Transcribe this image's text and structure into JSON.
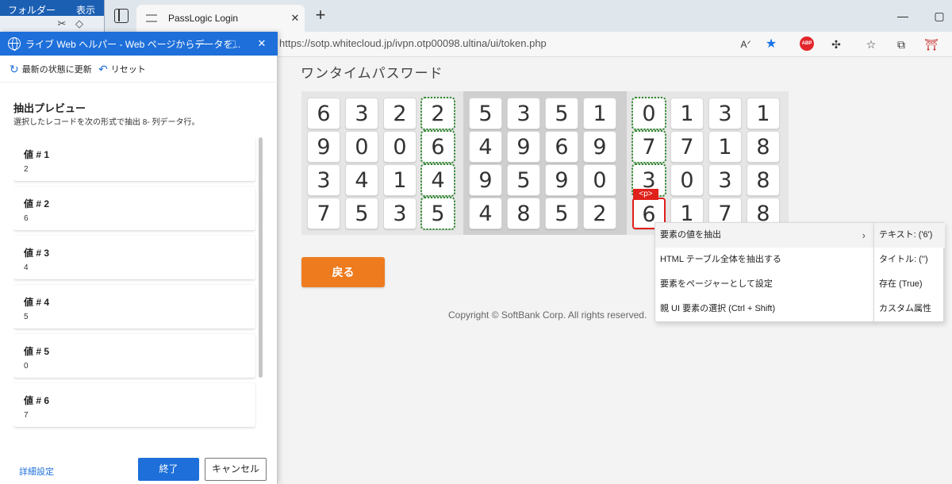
{
  "explorer": {
    "menu": [
      "フォルダー",
      "表示"
    ]
  },
  "browser": {
    "tab_title": "PassLogic Login",
    "url": "https://sotp.whitecloud.jp/ivpn.otp00098.ultina/ui/token.php",
    "extension_abp": "ABP"
  },
  "page": {
    "title": "ワンタイムパスワード",
    "grid": [
      [
        [
          "6",
          "3",
          "2",
          "2"
        ],
        [
          "9",
          "0",
          "0",
          "6"
        ],
        [
          "3",
          "4",
          "1",
          "4"
        ],
        [
          "7",
          "5",
          "3",
          "5"
        ]
      ],
      [
        [
          "5",
          "3",
          "5",
          "1"
        ],
        [
          "4",
          "9",
          "6",
          "9"
        ],
        [
          "9",
          "5",
          "9",
          "0"
        ],
        [
          "4",
          "8",
          "5",
          "2"
        ]
      ],
      [
        [
          "0",
          "1",
          "3",
          "1"
        ],
        [
          "7",
          "7",
          "1",
          "8"
        ],
        [
          "3",
          "0",
          "3",
          "8"
        ],
        [
          "6",
          "1",
          "7",
          "8"
        ]
      ]
    ],
    "element_tag": "<p>",
    "back_button": "戻る",
    "copyright": "Copyright © SoftBank Corp. All rights reserved."
  },
  "context_menu": {
    "items": [
      "要素の値を抽出",
      "HTML テーブル全体を抽出する",
      "要素をページャーとして設定",
      "親 UI 要素の選択 (Ctrl + Shift)"
    ],
    "submenu": [
      "テキスト: ('6')",
      "タイトル: ('')",
      "存在 (True)",
      "カスタム属性"
    ]
  },
  "helper": {
    "title": "ライブ Web ヘルパー - Web ページからデータを...",
    "refresh_label": "最新の状態に更新",
    "reset_label": "リセット",
    "section_title": "抽出プレビュー",
    "section_desc": "選択したレコードを次の形式で抽出 8- 列データ行。",
    "records": [
      {
        "label": "値 # 1",
        "value": "2"
      },
      {
        "label": "値 # 2",
        "value": "6"
      },
      {
        "label": "値 # 3",
        "value": "4"
      },
      {
        "label": "値 # 4",
        "value": "5"
      },
      {
        "label": "値 # 5",
        "value": "0"
      },
      {
        "label": "値 # 6",
        "value": "7"
      }
    ],
    "detail_link": "詳細設定",
    "ok_button": "終了",
    "cancel_button": "キャンセル"
  }
}
